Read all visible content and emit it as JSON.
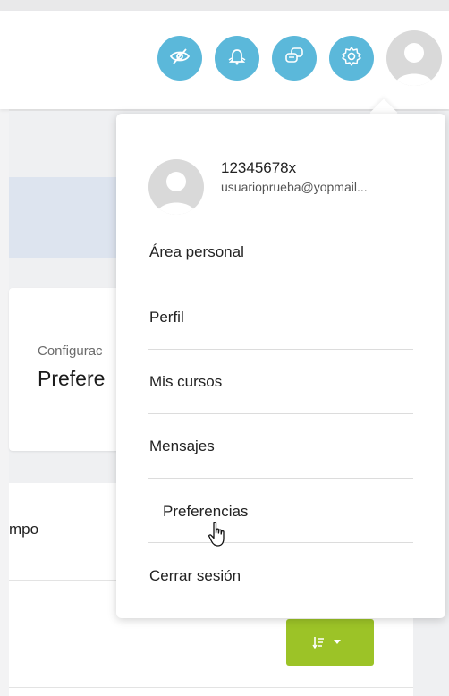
{
  "header": {
    "icons": [
      {
        "name": "eye-slash-icon"
      },
      {
        "name": "bell-icon"
      },
      {
        "name": "chat-icon"
      },
      {
        "name": "gear-icon"
      }
    ]
  },
  "background": {
    "card_subtitle": "Configurac",
    "card_title": "Prefere",
    "row_text": "mpo"
  },
  "user_menu": {
    "username": "12345678x",
    "email": "usuarioprueba@yopmail...",
    "items": [
      {
        "label": "Área personal"
      },
      {
        "label": "Perfil"
      },
      {
        "label": "Mis cursos"
      },
      {
        "label": "Mensajes"
      },
      {
        "label": "Preferencias"
      },
      {
        "label": "Cerrar sesión"
      }
    ]
  },
  "colors": {
    "icon_button": "#5bb8da",
    "green_button": "#9cc327"
  }
}
